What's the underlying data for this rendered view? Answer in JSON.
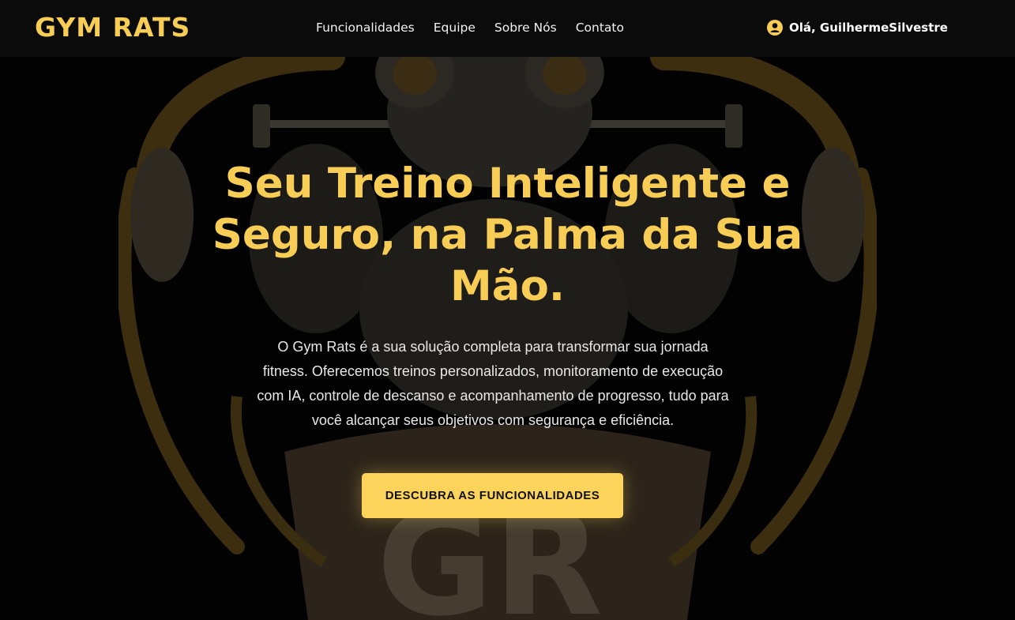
{
  "header": {
    "brand": "GYM RATS",
    "nav": [
      {
        "label": "Funcionalidades"
      },
      {
        "label": "Equipe"
      },
      {
        "label": "Sobre Nós"
      },
      {
        "label": "Contato"
      }
    ],
    "user_greeting": "Olá, GuilhermeSilvestre",
    "user_icon": "user-circle-icon"
  },
  "hero": {
    "title": "Seu Treino Inteligente e Seguro, na Palma da Sua Mão.",
    "description": "O Gym Rats é a sua solução completa para transformar sua jornada fitness. Oferecemos treinos personalizados, monitoramento de execução com IA, controle de descanso e acompanhamento de progresso, tudo para você alcançar seus objetivos com segurança e eficiência.",
    "cta_label": "DESCUBRA AS FUNCIONALIDADES",
    "background_logo": "gym-rats-mascot-logo"
  },
  "colors": {
    "accent": "#f8cd55",
    "button": "#fdd45b",
    "background": "#020202",
    "header_background": "#0b0b0b",
    "logo_tint": "#3a2c0f"
  }
}
